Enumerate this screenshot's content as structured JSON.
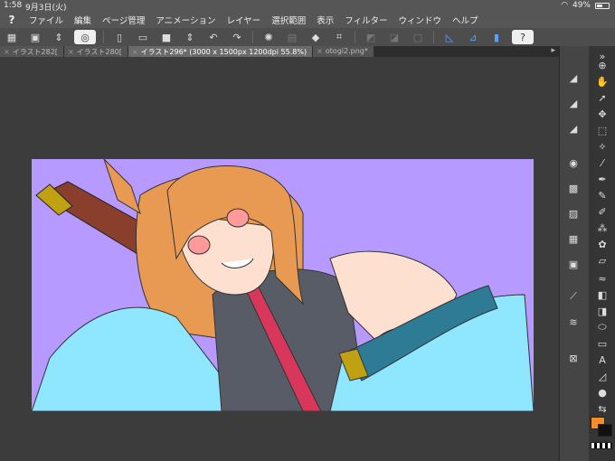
{
  "status_bar": {
    "time": "1:58",
    "date": "9月3日(火)",
    "battery": "49%"
  },
  "app": {
    "logo_glyph": "?"
  },
  "menu": [
    "ファイル",
    "編集",
    "ページ管理",
    "アニメーション",
    "レイヤー",
    "選択範囲",
    "表示",
    "フィルター",
    "ウィンドウ",
    "ヘルプ"
  ],
  "tabs": [
    {
      "label": "イラスト282[",
      "active": false
    },
    {
      "label": "イラスト280[",
      "active": false
    },
    {
      "label": "イラスト296* (3000 x 1500px 1200dpi 55.8%)",
      "active": true
    },
    {
      "label": "otogi2.png*",
      "active": false
    }
  ],
  "tab_close_glyph": "×",
  "colors": {
    "canvas_bg": "#b79aff",
    "main_color": "#f0902a",
    "sub_color": "#111111",
    "skin": "#fde0cf",
    "hair": "#e89a52",
    "kimono_light": "#8ee6ff",
    "kimono_dark": "#2d7b94",
    "vest": "#575c66",
    "sash": "#d8365a",
    "sword": "#8a3f2d",
    "gold": "#bfa112"
  }
}
